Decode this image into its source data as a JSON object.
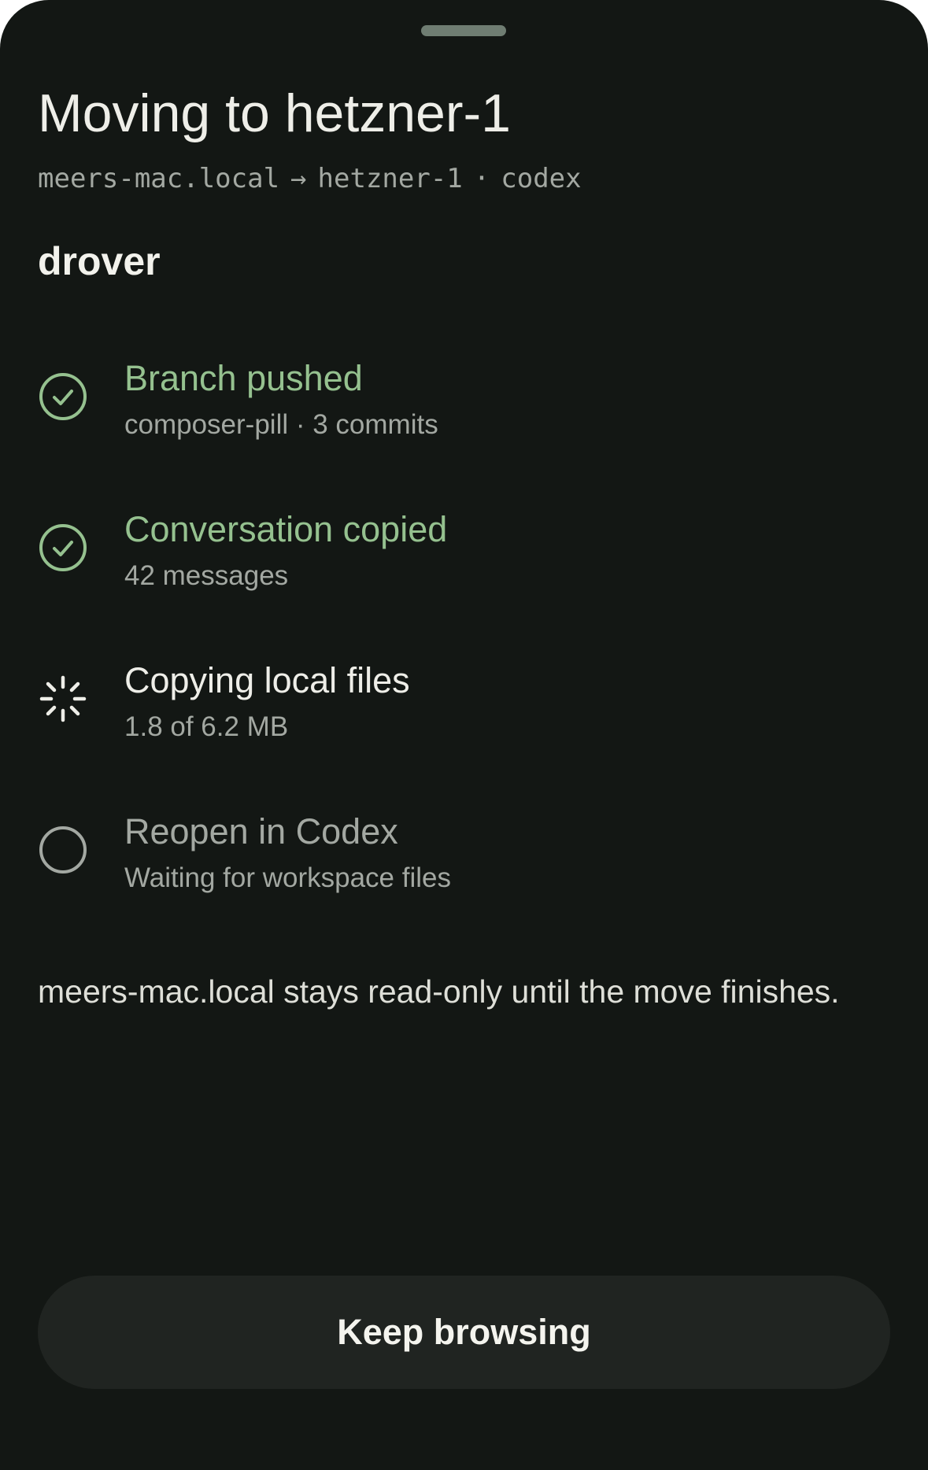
{
  "sheet": {
    "title": "Moving to hetzner-1",
    "route": {
      "source": "meers-mac.local",
      "arrow": "→",
      "target": "hetzner-1",
      "dot": "·",
      "agent": "codex"
    },
    "project": "drover"
  },
  "steps": [
    {
      "label": "Branch pushed",
      "detail": "composer-pill · 3 commits",
      "status": "done",
      "icon": "check-circle-icon"
    },
    {
      "label": "Conversation copied",
      "detail": "42 messages",
      "status": "done",
      "icon": "check-circle-icon"
    },
    {
      "label": "Copying local files",
      "detail": "1.8 of 6.2 MB",
      "status": "in-progress",
      "icon": "spinner-icon",
      "progress_mb": {
        "done": 1.8,
        "total": 6.2
      }
    },
    {
      "label": "Reopen in Codex",
      "detail": "Waiting for workspace files",
      "status": "pending",
      "icon": "empty-circle-icon"
    }
  ],
  "note": "meers-mac.local stays read-only until the move finishes.",
  "actions": {
    "keep_browsing_label": "Keep browsing"
  },
  "colors": {
    "background": "#131714",
    "done_green": "#95c18f",
    "muted_text": "#a3a8a2",
    "primary_text": "#eeeee8",
    "button_bg": "#202421",
    "handle": "#6f7d72"
  }
}
